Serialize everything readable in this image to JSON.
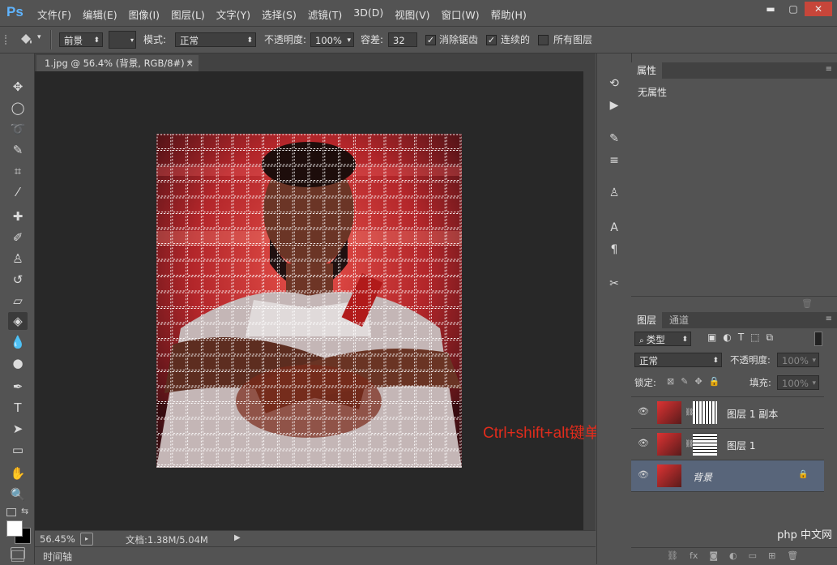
{
  "app": {
    "logo": "Ps"
  },
  "menu": [
    "文件(F)",
    "编辑(E)",
    "图像(I)",
    "图层(L)",
    "文字(Y)",
    "选择(S)",
    "滤镜(T)",
    "3D(D)",
    "视图(V)",
    "窗口(W)",
    "帮助(H)"
  ],
  "window_buttons": {
    "minimize": "▬",
    "restore": "▢",
    "close": "✕"
  },
  "options": {
    "fill_source": "前景",
    "mode_label": "模式:",
    "mode_value": "正常",
    "opacity_label": "不透明度:",
    "opacity_value": "100%",
    "tolerance_label": "容差:",
    "tolerance_value": "32",
    "antialias_label": "消除锯齿",
    "contiguous_label": "连续的",
    "all_layers_label": "所有图层"
  },
  "document": {
    "tab_title": "1.jpg @ 56.4% (背景, RGB/8#) *",
    "tab_close": "×",
    "zoom": "56.45%",
    "doc_info": "文档:1.38M/5.04M",
    "timeline_label": "时间轴"
  },
  "properties": {
    "tab": "属性",
    "content": "无属性"
  },
  "layers_panel": {
    "tabs": [
      "图层",
      "通道"
    ],
    "filter_type": "类型",
    "blend_mode": "正常",
    "opacity_label": "不透明度:",
    "opacity_value": "100%",
    "lock_label": "锁定:",
    "fill_label": "填充:",
    "fill_value": "100%",
    "layers": [
      {
        "name": "图层 1 副本",
        "visible": true,
        "selected": false,
        "mask": "stripes"
      },
      {
        "name": "图层 1",
        "visible": true,
        "selected": false,
        "mask": "hstripes"
      },
      {
        "name": "背景",
        "visible": true,
        "selected": true,
        "locked": true
      }
    ]
  },
  "annotation": "Ctrl+shift+alt键单击",
  "watermark": "php 中文网",
  "colors": {
    "panel_bg": "#535353",
    "canvas_bg": "#282828",
    "selected_layer": "#58657a",
    "annotation": "#e02c1c",
    "ps_blue": "#5fb4ff"
  }
}
